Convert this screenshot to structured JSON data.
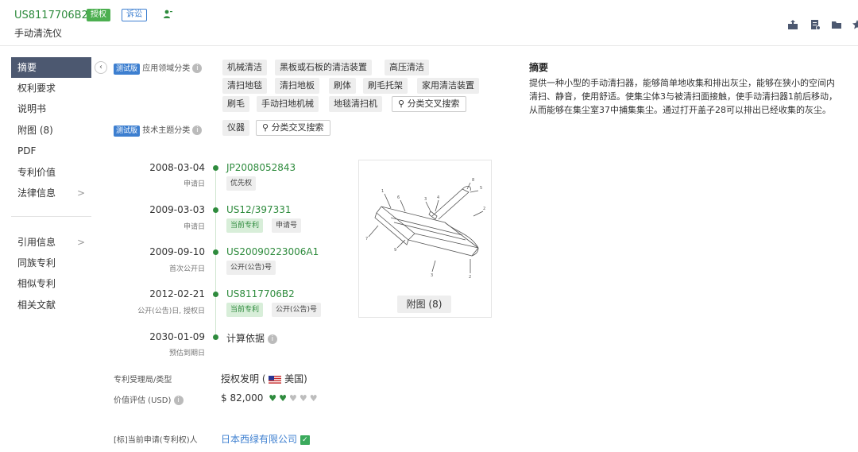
{
  "header": {
    "patent_number": "US8117706B2",
    "status_badge": "授权",
    "litigation_badge": "诉讼",
    "title": "手动清洗仪",
    "icons": [
      "person-icon",
      "share-icon",
      "report-icon",
      "folder-icon",
      "star-icon"
    ]
  },
  "sidebar": {
    "items": [
      {
        "label": "摘要",
        "active": true
      },
      {
        "label": "权利要求"
      },
      {
        "label": "说明书"
      },
      {
        "label": "附图 (8)"
      },
      {
        "label": "PDF"
      },
      {
        "label": "专利价值"
      },
      {
        "label": "法律信息",
        "chevron": ">"
      }
    ],
    "items2": [
      {
        "label": "引用信息",
        "chevron": ">"
      },
      {
        "label": "同族专利"
      },
      {
        "label": "相似专利"
      },
      {
        "label": "相关文献"
      }
    ],
    "collapse_icon": "‹"
  },
  "classification": {
    "beta_label": "测试版",
    "app_field_label": "应用领域分类",
    "app_field_tags": [
      "机械清洁",
      "黑板或石板的清洁装置",
      "高压清洁",
      "清扫地毯",
      "清扫地板",
      "刷体",
      "刷毛托架",
      "家用清洁装置",
      "刷毛",
      "手动扫地机械",
      "地毯清扫机"
    ],
    "tech_label": "技术主题分类",
    "tech_tags": [
      "仪器"
    ],
    "cross_search": "分类交叉搜索"
  },
  "timeline": [
    {
      "date": "2008-03-04",
      "sub": "申请日",
      "number": "JP2008052843",
      "chips": [
        {
          "text": "优先权",
          "style": "gray"
        }
      ]
    },
    {
      "date": "2009-03-03",
      "sub": "申请日",
      "number": "US12/397331",
      "chips": [
        {
          "text": "当前专利",
          "style": "green"
        },
        {
          "text": "申请号",
          "style": "gray"
        }
      ]
    },
    {
      "date": "2009-09-10",
      "sub": "首次公开日",
      "number": "US20090223006A1",
      "chips": [
        {
          "text": "公开(公告)号",
          "style": "gray"
        }
      ]
    },
    {
      "date": "2012-02-21",
      "sub": "公开(公告)日, 授权日",
      "number": "US8117706B2",
      "chips": [
        {
          "text": "当前专利",
          "style": "green"
        },
        {
          "text": "公开(公告)号",
          "style": "gray"
        }
      ]
    },
    {
      "date": "2030-01-09",
      "sub": "预估到期日",
      "text": "计算依据"
    }
  ],
  "figure": {
    "caption": "附图 (8)"
  },
  "details": {
    "office_label": "专利受理局/类型",
    "office_value": "授权发明 (",
    "office_country": "美国)",
    "value_label": "价值评估 (USD)",
    "value_amount": "$ 82,000",
    "value_rating": 2,
    "value_max": 5,
    "applicant_label": "[标]当前申请(专利权)人",
    "applicant_value": "日本西绿有限公司"
  },
  "abstract": {
    "title": "摘要",
    "lines": [
      "提供一种小型的手动清扫器，能够简单地收集和排出灰尘，能够在狭小的空间内",
      "清扫、静音，使用舒适。使集尘体3与被清扫面接触，使手动清扫器1前后移动，",
      "从而能够在集尘室37中捕集集尘。通过打开盖子28可以排出已经收集的灰尘。"
    ]
  },
  "colors": {
    "brand_green": "#2e8b3d",
    "nav_active": "#4c5870",
    "link_blue": "#3d7fd0"
  }
}
